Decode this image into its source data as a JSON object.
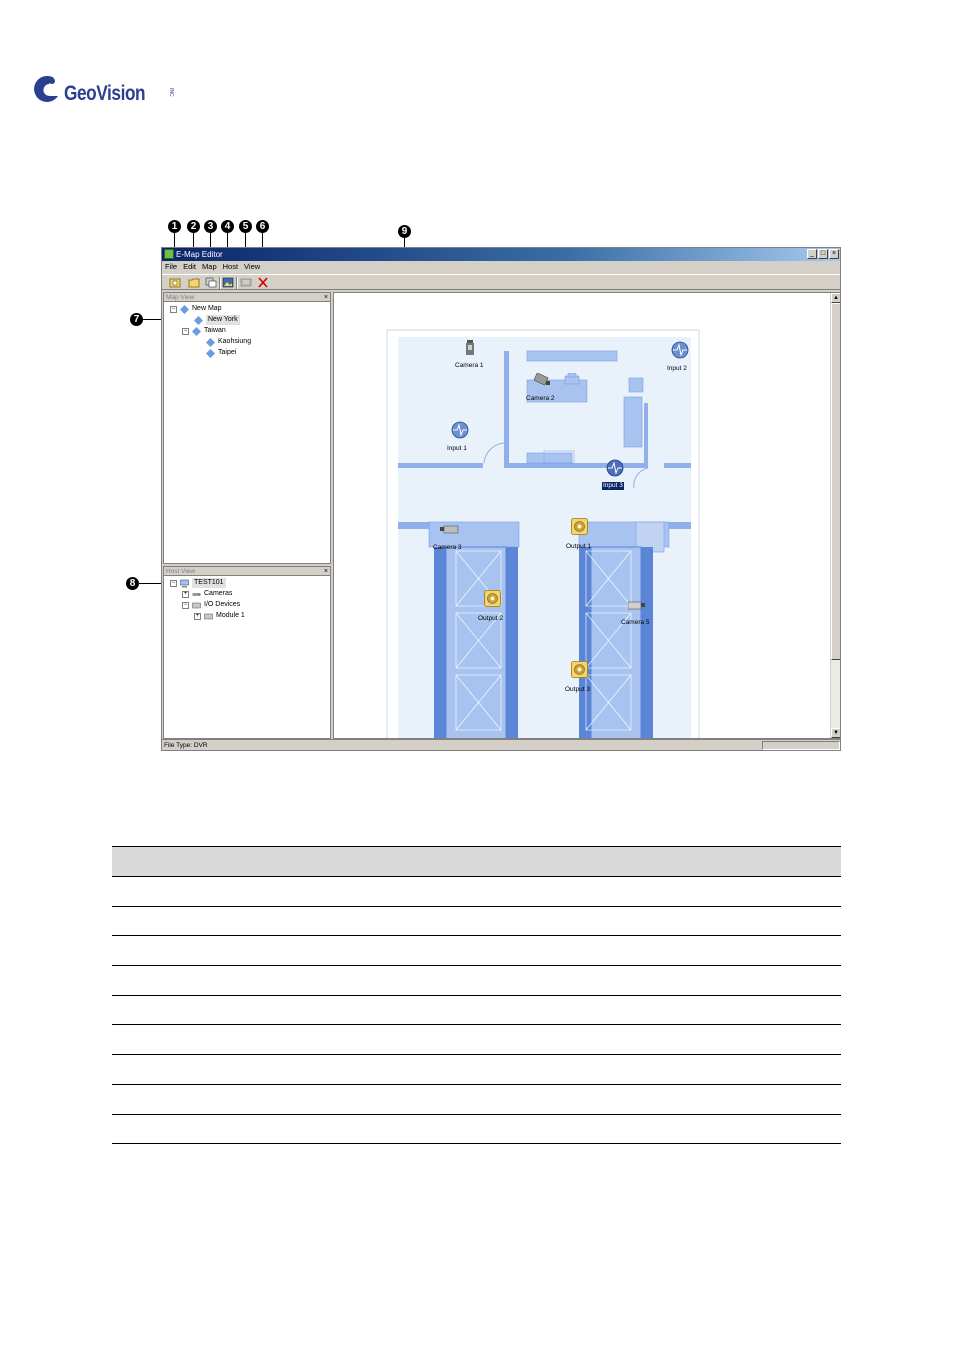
{
  "logo": {
    "name": "GeoVision",
    "mark": "INC"
  },
  "callouts": [
    "1",
    "2",
    "3",
    "4",
    "5",
    "6",
    "7",
    "8",
    "9"
  ],
  "window": {
    "title": "E-Map Editor",
    "buttons": {
      "minimize": "_",
      "maximize": "□",
      "close": "×"
    }
  },
  "menu": [
    "File",
    "Edit",
    "Map",
    "Host",
    "View"
  ],
  "map_view_panel": {
    "title": "Map View",
    "close": "×",
    "tree": [
      "New Map",
      "New York",
      "Taiwan",
      "Kaohsiung",
      "Taipei"
    ]
  },
  "host_view_panel": {
    "title": "Host View",
    "close": "×",
    "tree": [
      "TEST101",
      "Cameras",
      "I/O Devices",
      "Module 1"
    ]
  },
  "status": {
    "file_type": "File Type: DVR"
  },
  "map_labels": {
    "camera1": "Camera 1",
    "camera2": "Camera 2",
    "camera3": "Camera 3",
    "camera5": "Camera 5",
    "input1": "Input 1",
    "input2": "Input 2",
    "input3": "Input 3",
    "output1": "Output 1",
    "output2": "Output 2",
    "output3": "Output 3"
  },
  "colors": {
    "floor": "#e9f2fb",
    "wall": "#8fb0ea",
    "furniture": "#a8c3f0",
    "dark_blue": "#5b86d8",
    "titlebar": "#0a246a"
  },
  "table": {
    "rows": 9
  }
}
